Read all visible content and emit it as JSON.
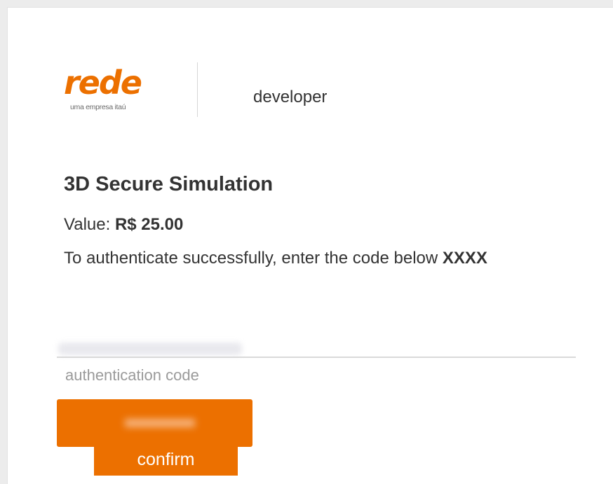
{
  "brand": {
    "logo_text": "rede",
    "logo_tagline": "uma empresa itaú",
    "section_label": "developer",
    "accent_color": "#ec7000"
  },
  "simulation": {
    "title": "3D Secure Simulation",
    "value_label": "Value:",
    "value_amount": "R$ 25.00",
    "instruction_text": "To authenticate successfully, enter the code below",
    "instruction_code": "XXXX"
  },
  "form": {
    "code_input_value": "",
    "code_caption": "authentication code",
    "confirm_label": "confirm"
  }
}
